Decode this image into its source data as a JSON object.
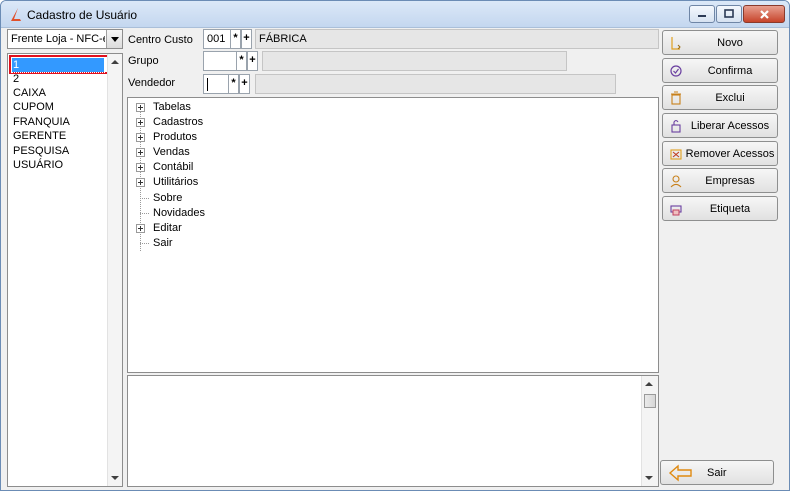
{
  "window": {
    "title": "Cadastro de Usuário"
  },
  "left": {
    "module_combo": "Frente Loja - NFC-e",
    "users": [
      "1",
      "2",
      "CAIXA",
      "CUPOM",
      "FRANQUIA",
      "GERENTE",
      "PESQUISA",
      "USUÁRIO"
    ],
    "selected_index": 0
  },
  "fields": {
    "centro_custo": {
      "label": "Centro Custo",
      "code": "001",
      "description": "FÁBRICA"
    },
    "grupo": {
      "label": "Grupo",
      "code": "",
      "description": ""
    },
    "vendedor": {
      "label": "Vendedor",
      "code": "",
      "description": ""
    },
    "lookup_label": "*",
    "add_label": "+"
  },
  "tree": [
    {
      "label": "Tabelas",
      "expandable": true
    },
    {
      "label": "Cadastros",
      "expandable": true
    },
    {
      "label": "Produtos",
      "expandable": true
    },
    {
      "label": "Vendas",
      "expandable": true
    },
    {
      "label": "Contábil",
      "expandable": true
    },
    {
      "label": "Utilitários",
      "expandable": true
    },
    {
      "label": "Sobre",
      "expandable": false
    },
    {
      "label": "Novidades",
      "expandable": false
    },
    {
      "label": "Editar",
      "expandable": true
    },
    {
      "label": "Sair",
      "expandable": false
    }
  ],
  "buttons": {
    "novo": "Novo",
    "confirma": "Confirma",
    "exclui": "Exclui",
    "liberar": "Liberar Acessos",
    "remover": "Remover Acessos",
    "empresas": "Empresas",
    "etiqueta": "Etiqueta",
    "sair": "Sair"
  },
  "colors": {
    "selection": "#3399ff",
    "highlight_border": "#e0101e",
    "accent": "#e0502a"
  }
}
